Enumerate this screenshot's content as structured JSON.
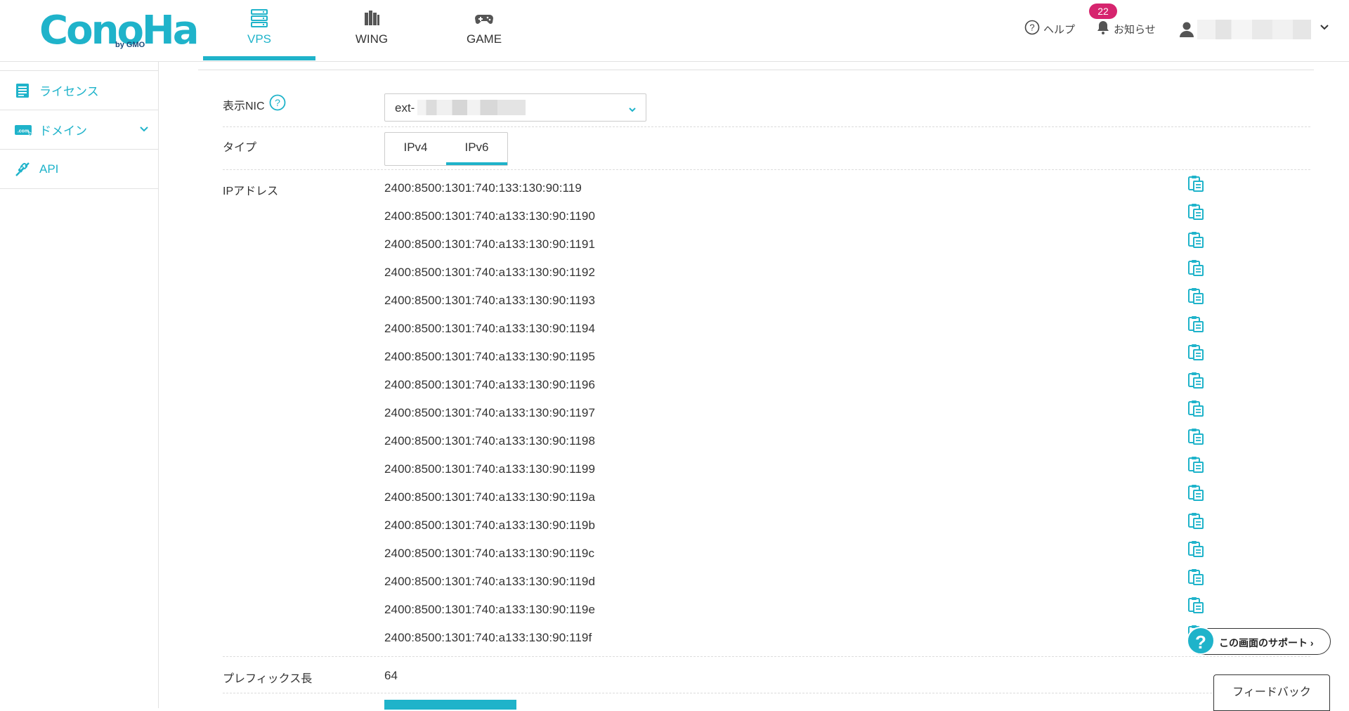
{
  "header": {
    "logo_text": "ConoHa",
    "logo_sub": "by GMO",
    "tabs": [
      {
        "label": "VPS",
        "icon": "server-icon",
        "active": true
      },
      {
        "label": "WING",
        "icon": "wing-icon",
        "active": false
      },
      {
        "label": "GAME",
        "icon": "gamepad-icon",
        "active": false
      }
    ],
    "help_label": "ヘルプ",
    "notice_label": "お知らせ",
    "notice_count": "22",
    "user_icon": "user-icon"
  },
  "sidebar": {
    "items": [
      {
        "label": "ライセンス",
        "icon": "license-icon"
      },
      {
        "label": "ドメイン",
        "icon": "domain-icon"
      },
      {
        "label": "API",
        "icon": "api-icon"
      }
    ]
  },
  "main": {
    "nic_label": "表示NIC",
    "nic_value": "ext-",
    "type_label": "タイプ",
    "type_options": [
      "IPv4",
      "IPv6"
    ],
    "type_selected": "IPv6",
    "ip_label": "IPアドレス",
    "ip_addresses": [
      "2400:8500:1301:740:133:130:90:119",
      "2400:8500:1301:740:a133:130:90:1190",
      "2400:8500:1301:740:a133:130:90:1191",
      "2400:8500:1301:740:a133:130:90:1192",
      "2400:8500:1301:740:a133:130:90:1193",
      "2400:8500:1301:740:a133:130:90:1194",
      "2400:8500:1301:740:a133:130:90:1195",
      "2400:8500:1301:740:a133:130:90:1196",
      "2400:8500:1301:740:a133:130:90:1197",
      "2400:8500:1301:740:a133:130:90:1198",
      "2400:8500:1301:740:a133:130:90:1199",
      "2400:8500:1301:740:a133:130:90:119a",
      "2400:8500:1301:740:a133:130:90:119b",
      "2400:8500:1301:740:a133:130:90:119c",
      "2400:8500:1301:740:a133:130:90:119d",
      "2400:8500:1301:740:a133:130:90:119e",
      "2400:8500:1301:740:a133:130:90:119f"
    ],
    "prefix_label": "プレフィックス長",
    "prefix_value": "64"
  },
  "support_label": "この画面のサポート",
  "feedback_label": "フィードバック",
  "colors": {
    "accent": "#1fb3ca",
    "badge": "#d6246e",
    "text": "#333333",
    "border": "#e2e2e2"
  }
}
